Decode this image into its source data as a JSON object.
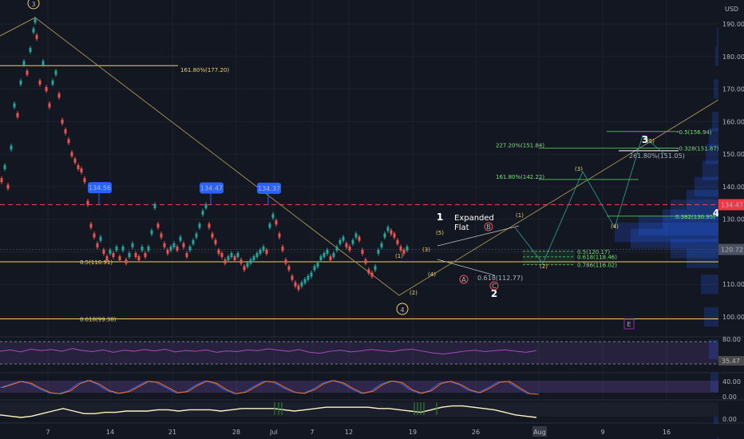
{
  "chart_data": {
    "type": "line",
    "currency": "USD",
    "price_axis": {
      "ticks": [
        "190.00",
        "180.00",
        "170.00",
        "160.00",
        "150.00",
        "140.00",
        "130.00",
        "120.00",
        "110.00",
        "100.00"
      ],
      "ylim": [
        87,
        196
      ]
    },
    "time_axis": {
      "ticks": [
        "7",
        "14",
        "21",
        "28",
        "Jul",
        "7",
        "12",
        "19",
        "26",
        "Aug",
        "9",
        "16"
      ]
    },
    "price_series": {
      "x": [
        0,
        4,
        8,
        12,
        16,
        20,
        24,
        28,
        32,
        36,
        40,
        42,
        44,
        48,
        52,
        56,
        60,
        64,
        68,
        72,
        76,
        80,
        84,
        88,
        92,
        96,
        100,
        104,
        108,
        112,
        116,
        120,
        124,
        128,
        132,
        136,
        140,
        144,
        148,
        152,
        156,
        160,
        164,
        168,
        172,
        176,
        180,
        184,
        188,
        192,
        196,
        200,
        204,
        208,
        212,
        216,
        220,
        224,
        228,
        232,
        236,
        240,
        244,
        248,
        252,
        256,
        260,
        264,
        268,
        272,
        276,
        280,
        284,
        288,
        292,
        296,
        300,
        304,
        308,
        312,
        316,
        320,
        324,
        328,
        332,
        336,
        340,
        344,
        348,
        352,
        356,
        360,
        364,
        368,
        372,
        376,
        380,
        384,
        388,
        392,
        396,
        400,
        404,
        408,
        412,
        416,
        420,
        424,
        428,
        432,
        436,
        440,
        444,
        448,
        452,
        456,
        460,
        464,
        468,
        472,
        476,
        480,
        484,
        488,
        492,
        496,
        500,
        504,
        508,
        512,
        516,
        520,
        524,
        528,
        532,
        536,
        540,
        544,
        548,
        552,
        556,
        560,
        564,
        568,
        572,
        576,
        580,
        584,
        588,
        592,
        596,
        600,
        604,
        608,
        612,
        616,
        620,
        624,
        628,
        632,
        636,
        640,
        644,
        648,
        652,
        656,
        660,
        664,
        668,
        672
      ],
      "y": [
        142,
        146,
        140,
        152,
        165,
        162,
        172,
        178,
        175,
        182,
        188,
        191,
        186,
        172,
        178,
        170,
        165,
        172,
        175,
        168,
        160,
        157,
        154,
        150,
        148,
        146,
        145,
        142,
        135,
        128,
        125,
        122,
        124,
        120,
        118,
        120,
        119,
        121,
        118,
        121,
        117,
        119,
        122,
        119,
        118,
        121,
        119,
        121,
        126,
        134,
        128,
        125,
        122,
        120,
        121,
        122,
        121,
        124,
        122,
        119,
        121,
        123,
        125,
        128,
        132,
        134,
        128,
        125,
        123,
        120,
        119,
        117,
        118,
        119,
        118,
        119,
        117,
        115,
        116,
        117,
        118,
        119,
        120,
        121,
        120,
        128,
        131,
        129,
        125,
        121,
        117,
        115,
        112,
        110,
        109,
        110,
        111,
        112,
        113,
        115,
        116,
        118,
        119,
        120,
        118,
        119,
        121,
        123,
        124,
        122,
        121,
        123,
        125,
        124,
        120,
        117,
        114,
        113,
        115,
        120,
        122,
        125,
        127,
        126,
        125,
        123,
        121,
        120,
        121
      ],
      "note": "daily closes, approximated"
    },
    "price_labels": [
      {
        "text": "134.56",
        "x": 124,
        "y": 134.56
      },
      {
        "text": "134.47",
        "x": 264,
        "y": 134.47
      },
      {
        "text": "134.37",
        "x": 336,
        "y": 134.37
      }
    ],
    "current_price": "120.72",
    "resistance_price": "134.47",
    "horizontal_levels": [
      {
        "label": "161.80%(177.20)",
        "value": 177.2
      },
      {
        "label": "0.5(116.91)",
        "value": 116.91
      },
      {
        "label": "0.618(99.38)",
        "value": 99.38
      }
    ],
    "projection_levels": [
      {
        "label": "-0.5(156.94)",
        "value": 156.94
      },
      {
        "label": "-0.328(151.87)",
        "value": 151.87
      },
      {
        "label": "227.20%(151.84)",
        "value": 151.84
      },
      {
        "label": "261.80%(151.05)",
        "value": 151.05
      },
      {
        "label": "161.80%(142.22)",
        "value": 142.22
      },
      {
        "label": "0.382(130.95)",
        "value": 130.95
      },
      {
        "label": "0.5(120.17)",
        "value": 120.17
      },
      {
        "label": "0.618(118.46)",
        "value": 118.46
      },
      {
        "label": "0.786(116.02)",
        "value": 116.02
      }
    ],
    "wave_labels": [
      "3",
      "4",
      "1",
      "2",
      "3",
      "4",
      "(1)",
      "(2)",
      "(3)",
      "(4)",
      "(5)",
      "(1)",
      "(2)",
      "(3)",
      "(4)",
      "(5)",
      "A",
      "B",
      "C",
      "0.618(112.77)",
      "E"
    ],
    "annotation": {
      "line1": "Expanded",
      "line2": "Flat"
    },
    "rsi": {
      "ticks": [
        "80.00",
        "35.47"
      ],
      "values": [
        58,
        62,
        56,
        64,
        60,
        63,
        58,
        66,
        60,
        57,
        62,
        55,
        61,
        58,
        63,
        59,
        64,
        56,
        60,
        58,
        62,
        55,
        59,
        57,
        62,
        60,
        65,
        61,
        58,
        63,
        55,
        52,
        58,
        61,
        56,
        59,
        63,
        60,
        57,
        62,
        64,
        58,
        53,
        50,
        54,
        58,
        61,
        57,
        60,
        62,
        58,
        55,
        60
      ]
    },
    "stoch": {
      "ticks": [
        "40.00",
        "0.00"
      ],
      "k": [
        40,
        55,
        70,
        60,
        35,
        15,
        10,
        25,
        60,
        75,
        55,
        25,
        12,
        20,
        45,
        70,
        65,
        40,
        15,
        20,
        50,
        72,
        60,
        30,
        10,
        18,
        45,
        70,
        66,
        40,
        18,
        12,
        30,
        60,
        74,
        62,
        35,
        12,
        22,
        55,
        72,
        64,
        30,
        12,
        25,
        60,
        70,
        55,
        28,
        15,
        38,
        66,
        70,
        40,
        12,
        8
      ]
    },
    "volume_osc": {
      "ticks": [
        "0.00"
      ],
      "values": [
        2,
        1,
        0,
        1,
        3,
        5,
        7,
        5,
        3,
        3,
        4,
        4,
        5,
        5,
        5,
        6,
        6,
        5,
        6,
        6,
        6,
        5,
        6,
        7,
        7,
        7,
        7,
        6,
        5,
        6,
        7,
        8,
        8,
        8,
        8,
        8,
        7,
        7,
        6,
        5,
        4,
        6,
        8,
        9,
        9,
        8,
        7,
        6,
        4,
        2,
        1,
        0
      ]
    }
  }
}
